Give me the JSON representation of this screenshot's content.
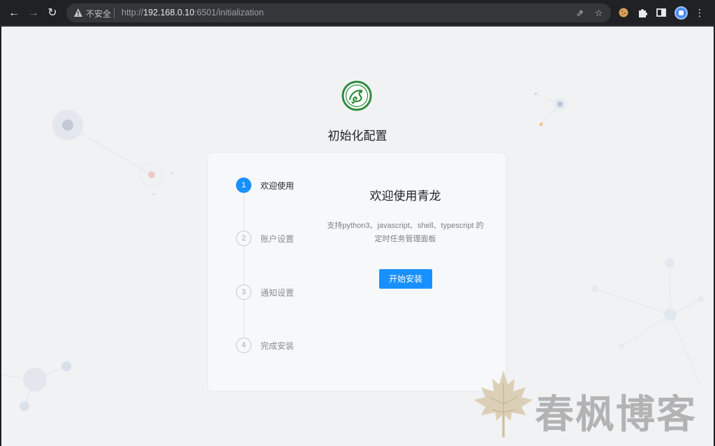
{
  "browser": {
    "insecure_label": "不安全",
    "url_prefix": "http://",
    "url_host": "192.168.0.10",
    "url_path": ":6501/initialization"
  },
  "page": {
    "title": "初始化配置"
  },
  "steps": [
    {
      "number": "1",
      "label": "欢迎使用",
      "active": true
    },
    {
      "number": "2",
      "label": "账户设置",
      "active": false
    },
    {
      "number": "3",
      "label": "通知设置",
      "active": false
    },
    {
      "number": "4",
      "label": "完成安装",
      "active": false
    }
  ],
  "welcome": {
    "title": "欢迎使用青龙",
    "desc_line1": "支持python3、javascript、shell、typescript 的",
    "desc_line2": "定时任务管理面板",
    "start_button": "开始安装"
  },
  "watermark": {
    "text": "春枫博客"
  },
  "colors": {
    "accent": "#1890ff",
    "page_bg": "#f1f2f4",
    "chrome_bg": "#202124"
  }
}
